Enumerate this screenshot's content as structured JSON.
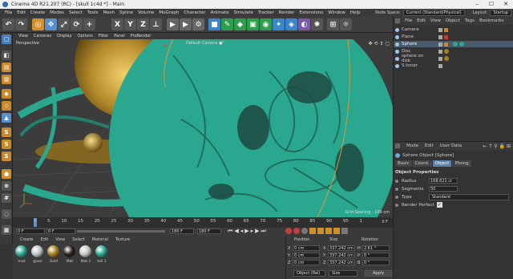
{
  "window": {
    "title": "Cinema 4D R21.207 (RC) - [skull 1c4d *] - Main",
    "min": "–",
    "max": "☐",
    "close": "✕"
  },
  "menu": {
    "items": [
      "File",
      "Edit",
      "Create",
      "Modes",
      "Select",
      "Tools",
      "Mesh",
      "Spline",
      "Volume",
      "MoGraph",
      "Character",
      "Animate",
      "Simulate",
      "Tracker",
      "Render",
      "Extensions",
      "Window",
      "Help"
    ],
    "node_space_label": "Node Space:",
    "node_space_value": "Current (Standard/Physical)",
    "layout_label": "Layout:",
    "layout_value": "Startup"
  },
  "viewport": {
    "menu": [
      "View",
      "Cameras",
      "Display",
      "Options",
      "Filter",
      "Panel",
      "ProRender"
    ],
    "perspective": "Perspective",
    "camera": "Default Camera ●°",
    "grid_spacing": "Grid Spacing : 100 cm"
  },
  "timeline": {
    "ticks": [
      "0",
      "5",
      "10",
      "15",
      "20",
      "25",
      "30",
      "35",
      "40",
      "45",
      "50",
      "55",
      "60",
      "65",
      "70",
      "75",
      "80",
      "85",
      "90",
      "95",
      "1"
    ],
    "end_frame": "0 F"
  },
  "timectl": {
    "start": "0 F",
    "current": "0 F",
    "end": "180 F",
    "max": "180 F"
  },
  "materials": {
    "menu": [
      "Create",
      "Edit",
      "View",
      "Select",
      "Material",
      "Texture"
    ],
    "items": [
      {
        "label": "mat",
        "color": "#2aa88f"
      },
      {
        "label": "glass",
        "color": "#bfc3c6"
      },
      {
        "label": "Gold",
        "color": "#a5801e"
      },
      {
        "label": "Mat",
        "color": "#2a1f1c"
      },
      {
        "label": "Mat.1",
        "color": "#c6c6c6"
      },
      {
        "label": "tell.1",
        "color": "#2aa88f"
      }
    ]
  },
  "coords": {
    "headers": [
      "Position",
      "Size",
      "Rotation"
    ],
    "rows": [
      {
        "axis": "X",
        "pos": "0 cm",
        "saxis": "X",
        "size": "337.242 cm",
        "raxis": "H",
        "rot": "2.61 °"
      },
      {
        "axis": "Y",
        "pos": "0 cm",
        "saxis": "Y",
        "size": "337.242 cm",
        "raxis": "P",
        "rot": "0 °"
      },
      {
        "axis": "Z",
        "pos": "0 cm",
        "saxis": "Z",
        "size": "337.242 cm",
        "raxis": "B",
        "rot": "0 °"
      }
    ],
    "mode": "Object (Rel)",
    "size_mode": "Size",
    "apply": "Apply"
  },
  "objects": {
    "menu": [
      "File",
      "Edit",
      "View",
      "Object",
      "Tags",
      "Bookmarks"
    ],
    "items": [
      {
        "name": "Camera",
        "color": "#9ec9e8"
      },
      {
        "name": "Plane",
        "color": "#9ec9e8"
      },
      {
        "name": "Sphere",
        "color": "#9ec9e8",
        "selected": true
      },
      {
        "name": "Disc",
        "color": "#9ec9e8"
      },
      {
        "name": "sphere on disk",
        "color": "#9ec9e8"
      },
      {
        "name": "S.toner",
        "color": "#9ec9e8"
      }
    ]
  },
  "attributes": {
    "menu": [
      "Mode",
      "Edit",
      "User Data"
    ],
    "object_title": "Sphere Object [Sphere]",
    "tabs": [
      "Basic",
      "Coord.",
      "Object",
      "Phong"
    ],
    "active_tab": "Object",
    "section": "Object Properties",
    "radius_label": "Radius",
    "radius_value": "168.621 cr",
    "segments_label": "Segments",
    "segments_value": "50",
    "type_label": "Type",
    "type_value": "Standard",
    "render_perfect_label": "Render Perfect",
    "render_perfect_checked": "✓"
  }
}
